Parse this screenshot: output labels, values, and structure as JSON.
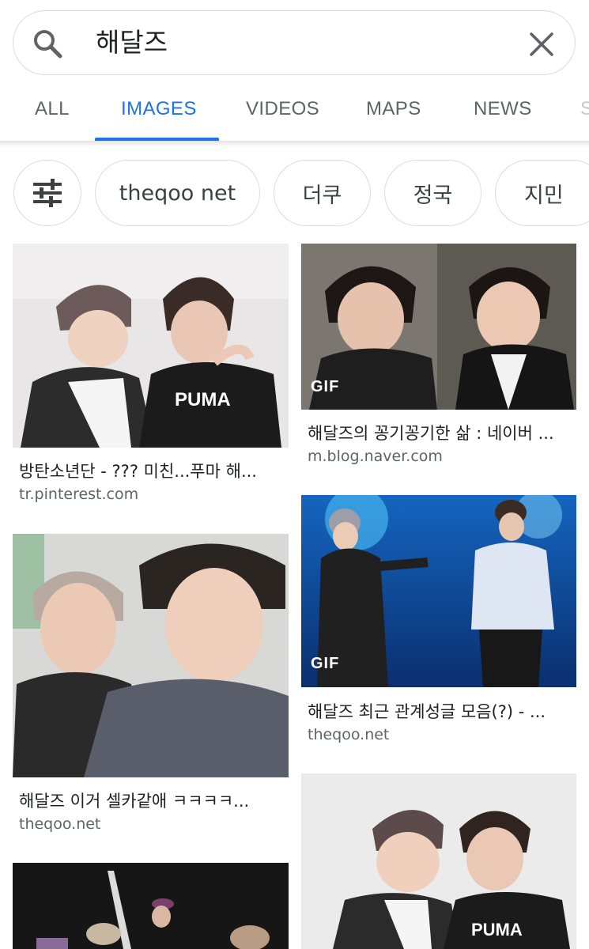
{
  "search": {
    "query": "해달즈",
    "search_icon": "search-icon",
    "clear_icon": "close-icon"
  },
  "tabs": [
    {
      "label": "ALL",
      "active": false
    },
    {
      "label": "IMAGES",
      "active": true
    },
    {
      "label": "VIDEOS",
      "active": false
    },
    {
      "label": "MAPS",
      "active": false
    },
    {
      "label": "NEWS",
      "active": false
    },
    {
      "label": "S",
      "active": false
    }
  ],
  "chips": [
    {
      "label": "",
      "icon": "tune-icon"
    },
    {
      "label": "theqoo net"
    },
    {
      "label": "더쿠"
    },
    {
      "label": "정국"
    },
    {
      "label": "지민"
    }
  ],
  "results": [
    {
      "title": "방탄소년단 - ??? 미친...푸마 해...",
      "source": "tr.pinterest.com",
      "gif": false
    },
    {
      "title": "해달즈의 꽁기꽁기한 삶 : 네이버 ...",
      "source": "m.blog.naver.com",
      "gif": true,
      "badge": "GIF"
    },
    {
      "title": "해달즈 최근 관계성글 모음(?) - ...",
      "source": "theqoo.net",
      "gif": true,
      "badge": "GIF"
    },
    {
      "title": "해달즈 이거 셀카같애 ㅋㅋㅋㅋ...",
      "source": "theqoo.net",
      "gif": false
    },
    {
      "title": "",
      "source": "",
      "gif": false
    },
    {
      "title": "",
      "source": "",
      "gif": false
    }
  ],
  "colors": {
    "accent": "#1a73e8",
    "tab_inactive": "#5f6368",
    "border": "#dadce0"
  }
}
